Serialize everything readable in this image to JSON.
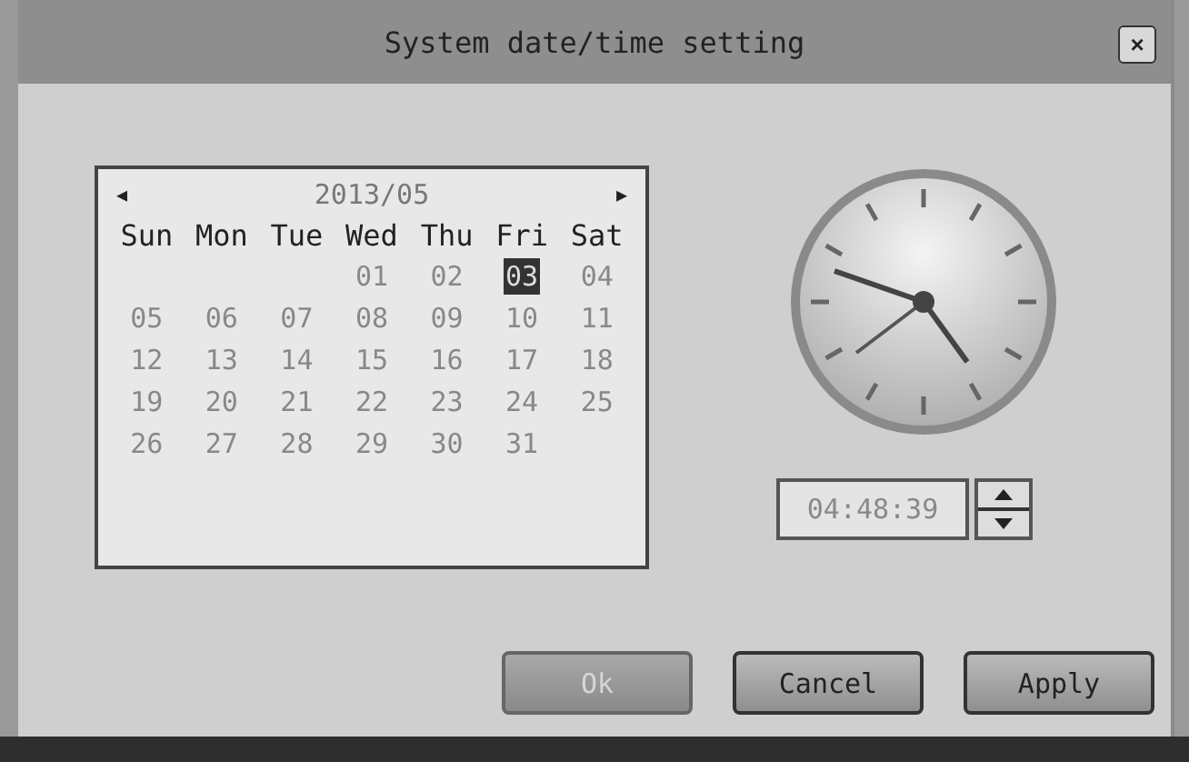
{
  "window": {
    "title": "System date/time setting",
    "close": "×"
  },
  "calendar": {
    "prev": "◂",
    "month": "2013/05",
    "next": "▸",
    "weekdays": [
      "Sun",
      "Mon",
      "Tue",
      "Wed",
      "Thu",
      "Fri",
      "Sat"
    ],
    "weeks": [
      [
        {
          "day": "01",
          "selected": false
        },
        {
          "day": "02",
          "selected": false
        },
        {
          "day": "03",
          "selected": true
        },
        {
          "day": "04",
          "selected": false
        }
      ],
      [
        {
          "day": "05",
          "selected": false
        },
        {
          "day": "06",
          "selected": false
        },
        {
          "day": "07",
          "selected": false
        },
        {
          "day": "08",
          "selected": false
        },
        {
          "day": "09",
          "selected": false
        },
        {
          "day": "10",
          "selected": false
        },
        {
          "day": "11",
          "selected": false
        }
      ],
      [
        {
          "day": "12",
          "selected": false
        },
        {
          "day": "13",
          "selected": false
        },
        {
          "day": "14",
          "selected": false
        },
        {
          "day": "15",
          "selected": false
        },
        {
          "day": "16",
          "selected": false
        },
        {
          "day": "17",
          "selected": false
        },
        {
          "day": "18",
          "selected": false
        }
      ],
      [
        {
          "day": "19",
          "selected": false
        },
        {
          "day": "20",
          "selected": false
        },
        {
          "day": "21",
          "selected": false
        },
        {
          "day": "22",
          "selected": false
        },
        {
          "day": "23",
          "selected": false
        },
        {
          "day": "24",
          "selected": false
        },
        {
          "day": "25",
          "selected": false
        }
      ],
      [
        {
          "day": "26",
          "selected": false
        },
        {
          "day": "27",
          "selected": false
        },
        {
          "day": "28",
          "selected": false
        },
        {
          "day": "29",
          "selected": false
        },
        {
          "day": "30",
          "selected": false
        },
        {
          "day": "31",
          "selected": false
        }
      ]
    ]
  },
  "time": {
    "value": "04:48:39"
  },
  "buttons": [
    {
      "label": "Ok",
      "disabled": true
    },
    {
      "label": "Cancel",
      "disabled": false
    },
    {
      "label": "Apply",
      "disabled": false
    }
  ]
}
